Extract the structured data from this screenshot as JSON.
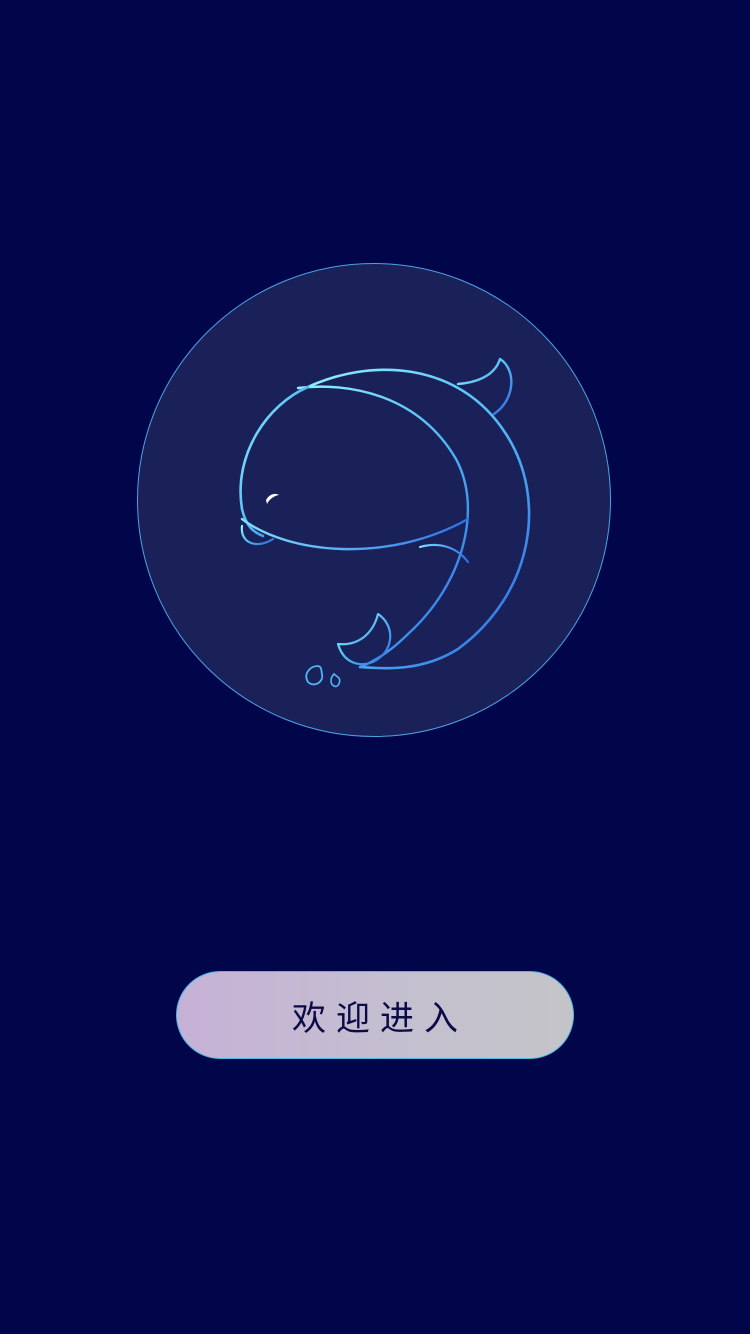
{
  "app": {
    "background_color": "#01064a",
    "accent_color": "#4aa3e6"
  },
  "logo": {
    "icon": "whale-logo-icon",
    "circle_color": "#1a2158",
    "stroke_color_light": "#7fe0ff",
    "stroke_color_dark": "#2a6de0"
  },
  "enter_button": {
    "label": "欢迎进入"
  }
}
